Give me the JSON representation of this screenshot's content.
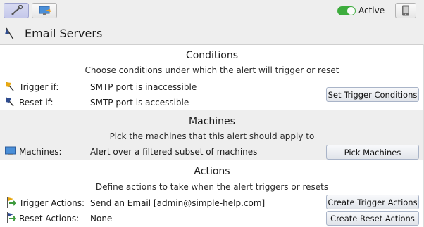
{
  "toolbar": {
    "active_label": "Active",
    "active": true,
    "accent_color": "#3dac3d"
  },
  "header": {
    "title": "Email Servers"
  },
  "conditions": {
    "title": "Conditions",
    "description": "Choose conditions under which the alert will trigger or reset",
    "trigger_label": "Trigger if:",
    "trigger_value": "SMTP port is inaccessible",
    "reset_label": "Reset if:",
    "reset_value": "SMTP port is accessible",
    "button_label": "Set Trigger Conditions"
  },
  "machines": {
    "title": "Machines",
    "description": "Pick the machines that this alert should apply to",
    "label": "Machines:",
    "value": "Alert over a filtered subset of machines",
    "button_label": "Pick Machines"
  },
  "actions": {
    "title": "Actions",
    "description": "Define actions to take when the alert triggers or resets",
    "trigger_label": "Trigger Actions:",
    "trigger_value": "Send an Email [admin@simple-help.com]",
    "trigger_button_label": "Create Trigger Actions",
    "reset_label": "Reset Actions:",
    "reset_value": "None",
    "reset_button_label": "Create Reset Actions"
  }
}
